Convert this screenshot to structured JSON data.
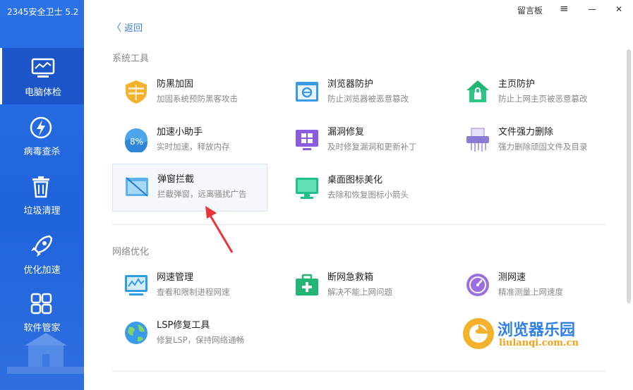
{
  "app": {
    "title": "2345安全卫士 5.2"
  },
  "topbar": {
    "guestbook": "留言板",
    "menu_icon": "≡",
    "minimize_icon": "—",
    "close_icon": "✕"
  },
  "nav": [
    {
      "label": "电脑体检",
      "icon": "monitor-icon",
      "active": true
    },
    {
      "label": "病毒查杀",
      "icon": "lightning-icon"
    },
    {
      "label": "垃圾清理",
      "icon": "trash-icon"
    },
    {
      "label": "优化加速",
      "icon": "rocket-icon"
    },
    {
      "label": "软件管家",
      "icon": "apps-icon"
    }
  ],
  "back": {
    "label": "返回"
  },
  "sections": [
    {
      "title": "系统工具",
      "tools": [
        {
          "name": "防黑加固",
          "desc": "加固系统预防黑客攻击",
          "icon": "shield-icon"
        },
        {
          "name": "浏览器防护",
          "desc": "防止浏览器被恶意篡改",
          "icon": "browser-icon"
        },
        {
          "name": "主页防护",
          "desc": "防止上网主页被恶意篡改",
          "icon": "home-lock-icon"
        },
        {
          "name": "加速小助手",
          "desc": "实时加速，释放内存",
          "icon": "memory-ball-icon"
        },
        {
          "name": "漏洞修复",
          "desc": "及时修复漏洞和更新补丁",
          "icon": "windows-patch-icon"
        },
        {
          "name": "文件强力删除",
          "desc": "强力删除顽固文件及目录",
          "icon": "shredder-icon"
        },
        {
          "name": "弹窗拦截",
          "desc": "拦截弹窗，远离骚扰广告",
          "icon": "popup-block-icon"
        },
        {
          "name": "桌面图标美化",
          "desc": "去除和恢复图标小箭头",
          "icon": "desktop-icon"
        }
      ]
    },
    {
      "title": "网络优化",
      "tools": [
        {
          "name": "网速管理",
          "desc": "查看和限制进程网速",
          "icon": "speed-monitor-icon"
        },
        {
          "name": "断网急救箱",
          "desc": "解决不能上网问题",
          "icon": "first-aid-icon"
        },
        {
          "name": "测网速",
          "desc": "精准测量上网速度",
          "icon": "speedometer-icon"
        },
        {
          "name": "LSP修复工具",
          "desc": "修复LSP，保持网络通畅",
          "icon": "globe-icon"
        }
      ]
    }
  ],
  "watermark": {
    "title": "浏览器乐园",
    "url": "liulanqi.com.cn"
  },
  "colors": {
    "sidebar": "#2a72e6",
    "accent": "#3b7fe0",
    "arrow": "#e8353b"
  }
}
